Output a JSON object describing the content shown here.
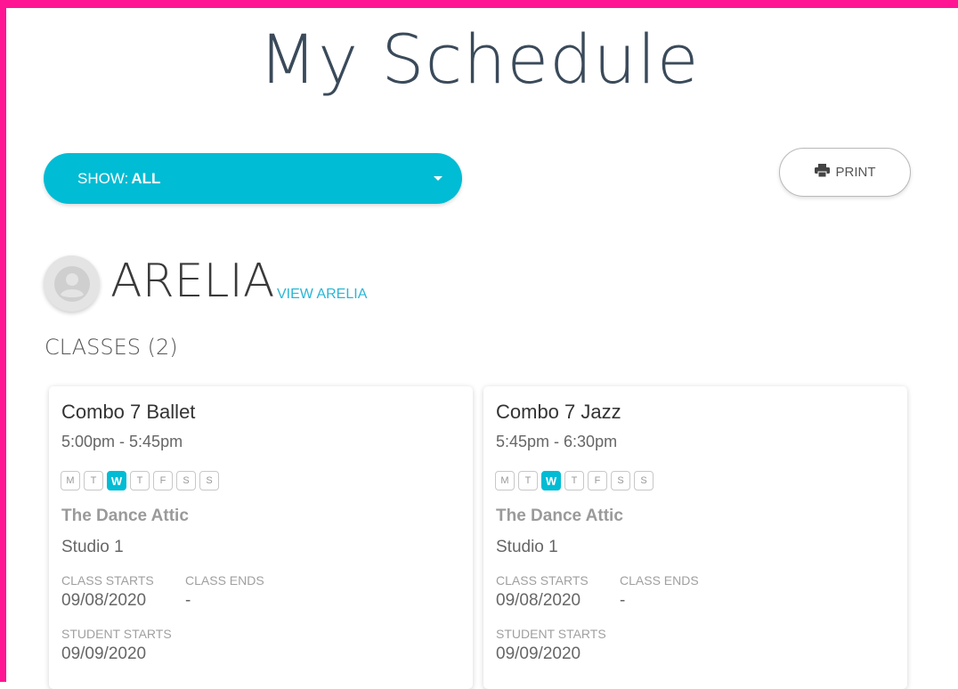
{
  "page": {
    "title": "My Schedule"
  },
  "filter": {
    "label": "SHOW:",
    "value": "ALL"
  },
  "print_button": {
    "label": "PRINT"
  },
  "student": {
    "name": "ARELIA",
    "view_link": "VIEW ARELIA"
  },
  "classes_heading": "CLASSES (2)",
  "labels": {
    "class_starts": "CLASS STARTS",
    "class_ends": "CLASS ENDS",
    "student_starts": "STUDENT STARTS"
  },
  "colors": {
    "accent": "#00bcd4",
    "frame": "#ff1493",
    "link": "#29b6d6"
  },
  "classes": [
    {
      "name": "Combo 7 Ballet",
      "time": "5:00pm - 5:45pm",
      "days": [
        "M",
        "T",
        "W",
        "T",
        "F",
        "S",
        "S"
      ],
      "active_day": "W",
      "location": "The Dance Attic",
      "room": "Studio 1",
      "class_starts": "09/08/2020",
      "class_ends": "-",
      "student_starts": "09/09/2020"
    },
    {
      "name": "Combo 7 Jazz",
      "time": "5:45pm - 6:30pm",
      "days": [
        "M",
        "T",
        "W",
        "T",
        "F",
        "S",
        "S"
      ],
      "active_day": "W",
      "location": "The Dance Attic",
      "room": "Studio 1",
      "class_starts": "09/08/2020",
      "class_ends": "-",
      "student_starts": "09/09/2020"
    }
  ],
  "icons": {
    "print": "printer-icon",
    "avatar": "user-avatar-icon",
    "dropdown": "caret-down-icon"
  }
}
